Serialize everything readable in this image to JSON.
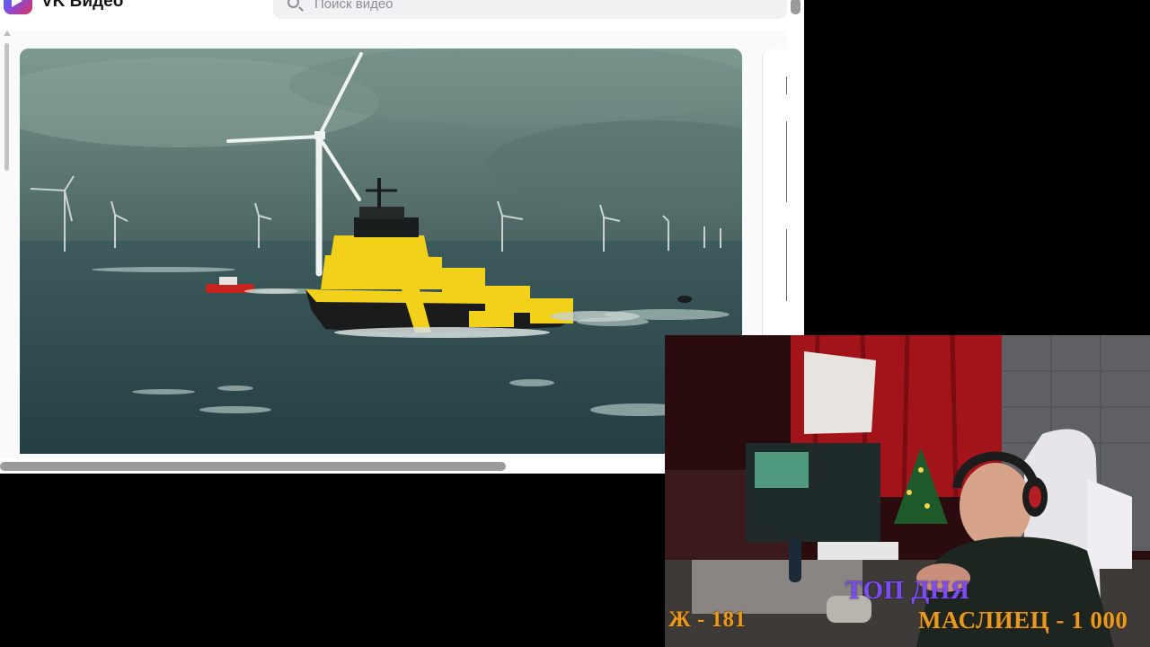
{
  "browser": {
    "app_title": "VK Видео",
    "search": {
      "placeholder": "Поиск видео",
      "value": ""
    }
  },
  "stream_overlay": {
    "top_label": "ТОП ДНЯ",
    "left_stat": "Ж - 181",
    "right_stat": "МАСЛИЕЦ - 1 000"
  },
  "colors": {
    "overlay_purple": "#7b4df0",
    "overlay_orange": "#e89a1e",
    "ship_yellow": "#f2d11b"
  }
}
